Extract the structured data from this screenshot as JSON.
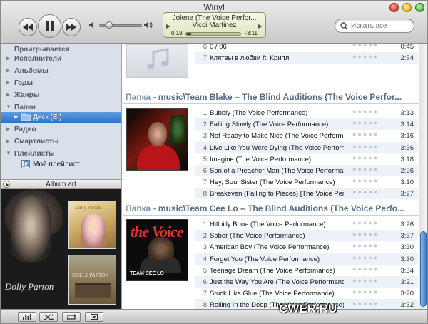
{
  "window": {
    "title": "Winyl"
  },
  "now_playing": {
    "title": "Jolene (The Voice Perfor...",
    "artist": "Vicci Martinez",
    "elapsed": "0:19",
    "remaining": "-3:11",
    "progress": 0.09
  },
  "volume": {
    "level": 0.25
  },
  "search": {
    "placeholder": "Искать все"
  },
  "sidebar": {
    "items": [
      {
        "label": "Проигрывается"
      },
      {
        "label": "Исполнители"
      },
      {
        "label": "Альбомы"
      },
      {
        "label": "Годы"
      },
      {
        "label": "Жанры"
      },
      {
        "label": "Папки"
      },
      {
        "label": "Диск (E:)"
      },
      {
        "label": "Радио"
      },
      {
        "label": "Смартлисты"
      },
      {
        "label": "Плейлисты"
      },
      {
        "label": "Мой плейлист"
      }
    ]
  },
  "album_art": {
    "title": "Album art",
    "artist_text": "Dolly Parton",
    "small1_text": "Dolly Parton",
    "small2_text": "DOLLY PARTON"
  },
  "folders": [
    {
      "tracks": [
        {
          "num": "6",
          "title": "0 / 06",
          "duration": "0:45"
        },
        {
          "num": "7",
          "title": "Клятвы в любви ft. Крипл",
          "duration": "2:54"
        }
      ]
    },
    {
      "prefix": "Папка",
      "sep": " - ",
      "path": "music\\Team Blake – The Blind Auditions (The Voice Perfor...",
      "tracks": [
        {
          "num": "1",
          "title": "Bubbly (The Voice Performance)",
          "duration": "3:13"
        },
        {
          "num": "2",
          "title": "Falling Slowly (The Voice Performance)",
          "duration": "3:14"
        },
        {
          "num": "3",
          "title": "Not Ready to Make Nice (The Voice Perform...",
          "duration": "3:16"
        },
        {
          "num": "4",
          "title": "Live Like You Were Dying (The Voice Perform...",
          "duration": "3:36"
        },
        {
          "num": "5",
          "title": "Imagine (The Voice Performance)",
          "duration": "3:18"
        },
        {
          "num": "6",
          "title": "Son of a Preacher Man (The Voice Performa...",
          "duration": "2:26"
        },
        {
          "num": "7",
          "title": "Hey, Soul Sister (The Voice Performance)",
          "duration": "3:10"
        },
        {
          "num": "8",
          "title": "Breakeven (Falling to Pieces) [The Voice Perform...",
          "duration": "3:27"
        }
      ]
    },
    {
      "prefix": "Папка",
      "sep": " - ",
      "path": "music\\Team Cee Lo – The Blind Auditions (The Voice Perfo...",
      "cover_text": "TEAM CEE LO",
      "cover_logo": "the Voice",
      "tracks": [
        {
          "num": "1",
          "title": "Hillbilly Bone (The Voice Performance)",
          "duration": "3:26"
        },
        {
          "num": "2",
          "title": "Sober (The Voice Performance)",
          "duration": "3:37"
        },
        {
          "num": "3",
          "title": "American Boy (The Voice Performance)",
          "duration": "3:30"
        },
        {
          "num": "4",
          "title": "Forget You (The Voice Performance)",
          "duration": "3:30"
        },
        {
          "num": "5",
          "title": "Teenage Dream (The Voice Performance)",
          "duration": "3:34"
        },
        {
          "num": "6",
          "title": "Just the Way You Are (The Voice Performance)",
          "duration": "3:21"
        },
        {
          "num": "7",
          "title": "Stuck Like Glue (The Voice Performance)",
          "duration": "3:20"
        },
        {
          "num": "8",
          "title": "Rolling In the Deep (The Voice Performance)",
          "duration": "3:32"
        }
      ]
    }
  ],
  "watermark": "CWER.RU",
  "colors": {
    "accent": "#2f73c8",
    "folder_header": "#566b85",
    "alt_row": "#edf2f9"
  }
}
